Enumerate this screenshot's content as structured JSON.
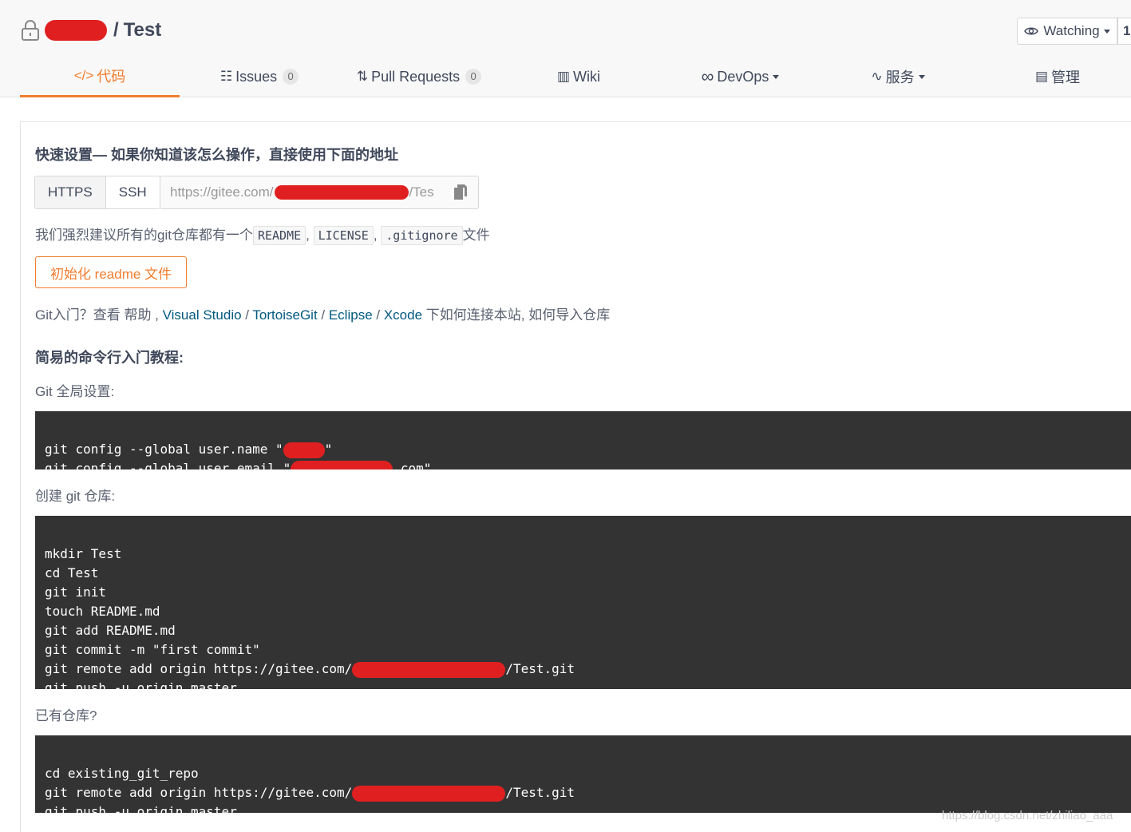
{
  "repo": {
    "name": "Test",
    "separator": "/"
  },
  "watch": {
    "label": "Watching",
    "count": "1"
  },
  "tabs": [
    {
      "icon": "</>",
      "label": "代码"
    },
    {
      "icon": "☷",
      "label": "Issues",
      "badge": "0"
    },
    {
      "icon": "⇅",
      "label": "Pull Requests",
      "badge": "0"
    },
    {
      "icon": "▥",
      "label": "Wiki"
    },
    {
      "icon": "∞",
      "label": "DevOps"
    },
    {
      "icon": "∿",
      "label": "服务"
    },
    {
      "icon": "▤",
      "label": "管理"
    }
  ],
  "quick_setup": {
    "title": "快速设置— 如果你知道该怎么操作，直接使用下面的地址",
    "protocols": [
      "HTTPS",
      "SSH"
    ],
    "url_prefix": "https://gitee.com/",
    "url_suffix": "/Tes"
  },
  "recommend": {
    "prefix": "我们强烈建议所有的git仓库都有一个",
    "files": [
      "README",
      "LICENSE",
      ".gitignore"
    ],
    "suffix": "文件"
  },
  "init_button": "初始化 readme 文件",
  "help": {
    "prefix": "Git入门？查看 帮助",
    "links": [
      "Visual Studio",
      "TortoiseGit",
      "Eclipse",
      "Xcode"
    ],
    "suffix_text": "下如何连接本站,",
    "import_link": "如何导入仓库"
  },
  "tutorial_title": "简易的命令行入门教程:",
  "global_label": "Git 全局设置:",
  "global_code": [
    "git config --global user.name \"",
    "git config --global user.email \""
  ],
  "global_tail": [
    "\"",
    ".com\""
  ],
  "create_label": "创建 git 仓库:",
  "create_code": [
    "mkdir Test",
    "cd Test",
    "git init",
    "touch README.md",
    "git add README.md",
    "git commit -m \"first commit\"",
    "git remote add origin https://gitee.com/",
    "git push -u origin master"
  ],
  "remote_tail": "/Test.git",
  "existing_label": "已有仓库?",
  "existing_code": [
    "cd existing_git_repo",
    "git remote add origin https://gitee.com/",
    "git push -u origin master"
  ],
  "watermark": "https://blog.csdn.net/zhiliao_aaa",
  "colors": {
    "accent": "#f27d2e",
    "link": "#005980",
    "code_bg": "#333333",
    "redact": "#e02020"
  }
}
